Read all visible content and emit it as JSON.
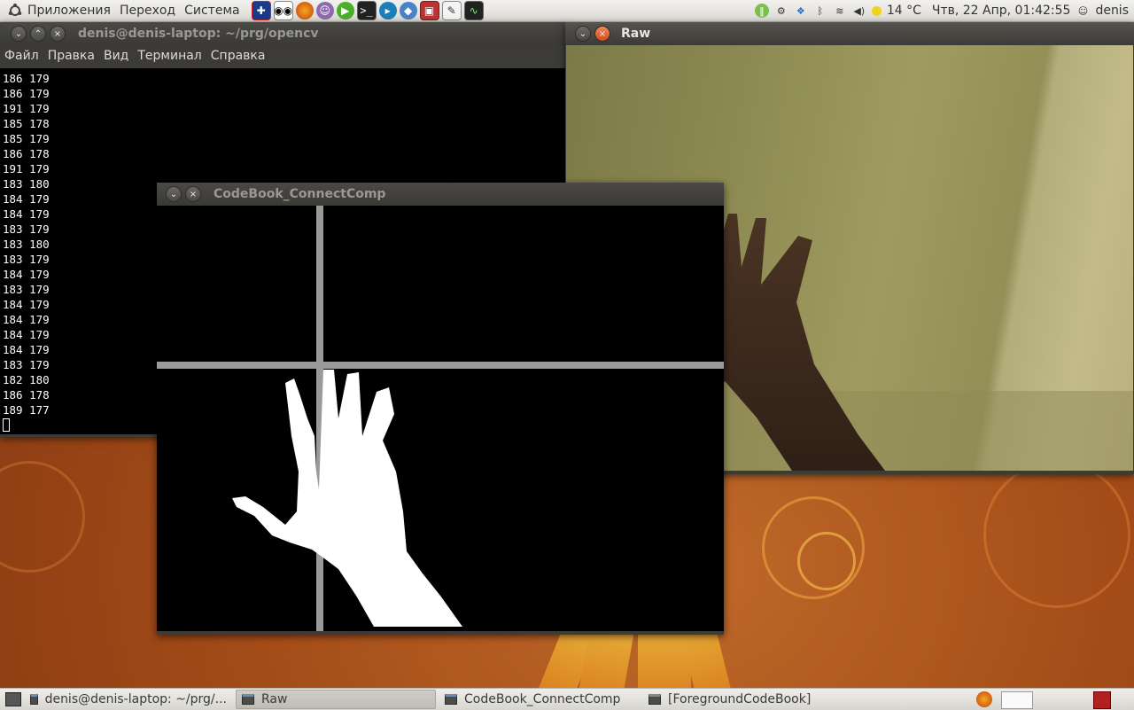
{
  "top_panel": {
    "menus": [
      "Приложения",
      "Переход",
      "Система"
    ],
    "launchers": [
      "flag-uk-icon",
      "eyes-icon",
      "firefox-icon",
      "pidgin-icon",
      "play-icon",
      "terminal-icon",
      "media-icon",
      "bird-icon",
      "screenshot-icon",
      "editor-icon",
      "monitor-icon"
    ],
    "tray": {
      "weather": "14 °C",
      "clock": "Чтв, 22 Апр, 01:42:55",
      "user": "denis"
    }
  },
  "terminal": {
    "title": "denis@denis-laptop: ~/prg/opencv",
    "menu": [
      "Файл",
      "Правка",
      "Вид",
      "Терминал",
      "Справка"
    ],
    "lines": [
      "186 179",
      "186 179",
      "191 179",
      "185 178",
      "185 179",
      "186 178",
      "191 179",
      "183 180",
      "184 179",
      "184 179",
      "183 179",
      "183 180",
      "183 179",
      "184 179",
      "183 179",
      "184 179",
      "184 179",
      "184 179",
      "184 179",
      "183 179",
      "182 180",
      "186 178",
      "189 177"
    ]
  },
  "codebook_window": {
    "title": "CodeBook_ConnectComp"
  },
  "raw_window": {
    "title": "Raw"
  },
  "taskbar": {
    "items": [
      {
        "label": "denis@denis-laptop: ~/prg/...",
        "active": false
      },
      {
        "label": "Raw",
        "active": true
      },
      {
        "label": "CodeBook_ConnectComp",
        "active": false
      },
      {
        "label": "[ForegroundCodeBook]",
        "active": false
      }
    ]
  },
  "colors": {
    "panel": "#dcdad5",
    "title_active": "#e8e6e1",
    "wallpaper": "#a44c18"
  }
}
